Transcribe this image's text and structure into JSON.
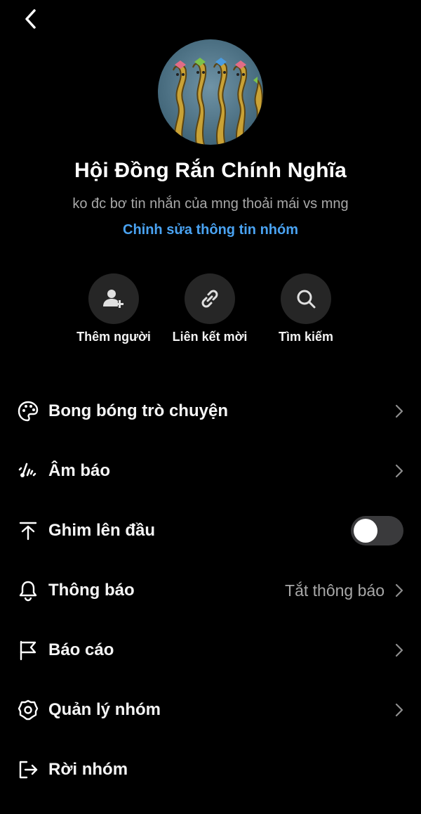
{
  "group": {
    "name": "Hội Đồng Rắn Chính Nghĩa",
    "description": "ko đc bơ tin nhắn của mng thoải mái vs mng",
    "edit_link": "Chỉnh sửa thông tin nhóm"
  },
  "actions": [
    {
      "label": "Thêm người",
      "icon": "add-person-icon"
    },
    {
      "label": "Liên kết mời",
      "icon": "link-icon"
    },
    {
      "label": "Tìm kiếm",
      "icon": "search-icon"
    }
  ],
  "settings": [
    {
      "label": "Bong bóng trò chuyện",
      "icon": "palette-icon"
    },
    {
      "label": "Âm báo",
      "icon": "sound-icon"
    },
    {
      "label": "Ghim lên đầu",
      "icon": "pin-top-icon",
      "toggle_on": false
    },
    {
      "label": "Thông báo",
      "icon": "bell-icon",
      "value": "Tắt thông báo"
    },
    {
      "label": "Báo cáo",
      "icon": "flag-icon"
    },
    {
      "label": "Quản lý nhóm",
      "icon": "gear-icon"
    },
    {
      "label": "Rời nhóm",
      "icon": "leave-icon"
    }
  ],
  "colors": {
    "background": "#000000",
    "accent_link": "#4aa3f2",
    "secondary_text": "#a8a8a8",
    "circle_bg": "#262626"
  }
}
